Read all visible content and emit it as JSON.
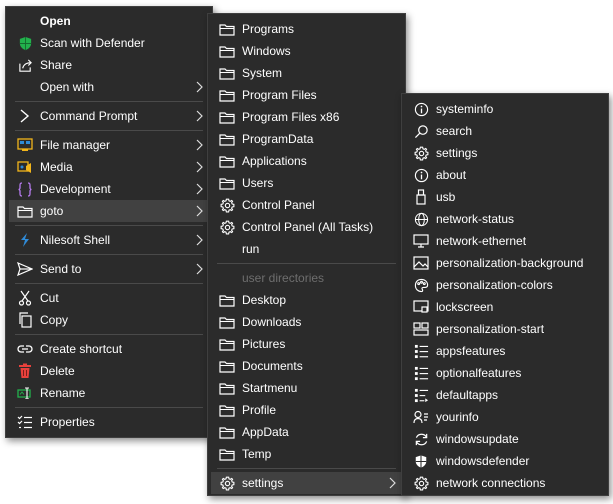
{
  "menu1": {
    "open": "Open",
    "scan": "Scan with Defender",
    "share": "Share",
    "open_with": "Open with",
    "command_prompt": "Command Prompt",
    "file_manager": "File manager",
    "media": "Media",
    "development": "Development",
    "goto": "goto",
    "nilesoft_shell": "Nilesoft Shell",
    "send_to": "Send to",
    "cut": "Cut",
    "copy": "Copy",
    "create_shortcut": "Create shortcut",
    "delete": "Delete",
    "rename": "Rename",
    "properties": "Properties"
  },
  "menu2": {
    "items": [
      "Programs",
      "Windows",
      "System",
      "Program Files",
      "Program Files x86",
      "ProgramData",
      "Applications",
      "Users",
      "Control Panel",
      "Control Panel (All Tasks)",
      "run"
    ],
    "section_header": "user directories",
    "user_dirs": [
      "Desktop",
      "Downloads",
      "Pictures",
      "Documents",
      "Startmenu",
      "Profile",
      "AppData",
      "Temp"
    ],
    "settings": "settings"
  },
  "menu3": {
    "items": [
      "systeminfo",
      "search",
      "settings",
      "about",
      "usb",
      "network-status",
      "network-ethernet",
      "personalization-background",
      "personalization-colors",
      "lockscreen",
      "personalization-start",
      "appsfeatures",
      "optionalfeatures",
      "defaultapps",
      "yourinfo",
      "windowsupdate",
      "windowsdefender",
      "network connections"
    ]
  },
  "colors": {
    "menu_bg": "#2b2b2b",
    "highlight": "#414141",
    "separator": "#4a4a4a",
    "folder": "#ffffff",
    "defender_green": "#22b14c",
    "delete_red": "#e8413c",
    "nilesoft_blue": "#2f8bd8"
  }
}
